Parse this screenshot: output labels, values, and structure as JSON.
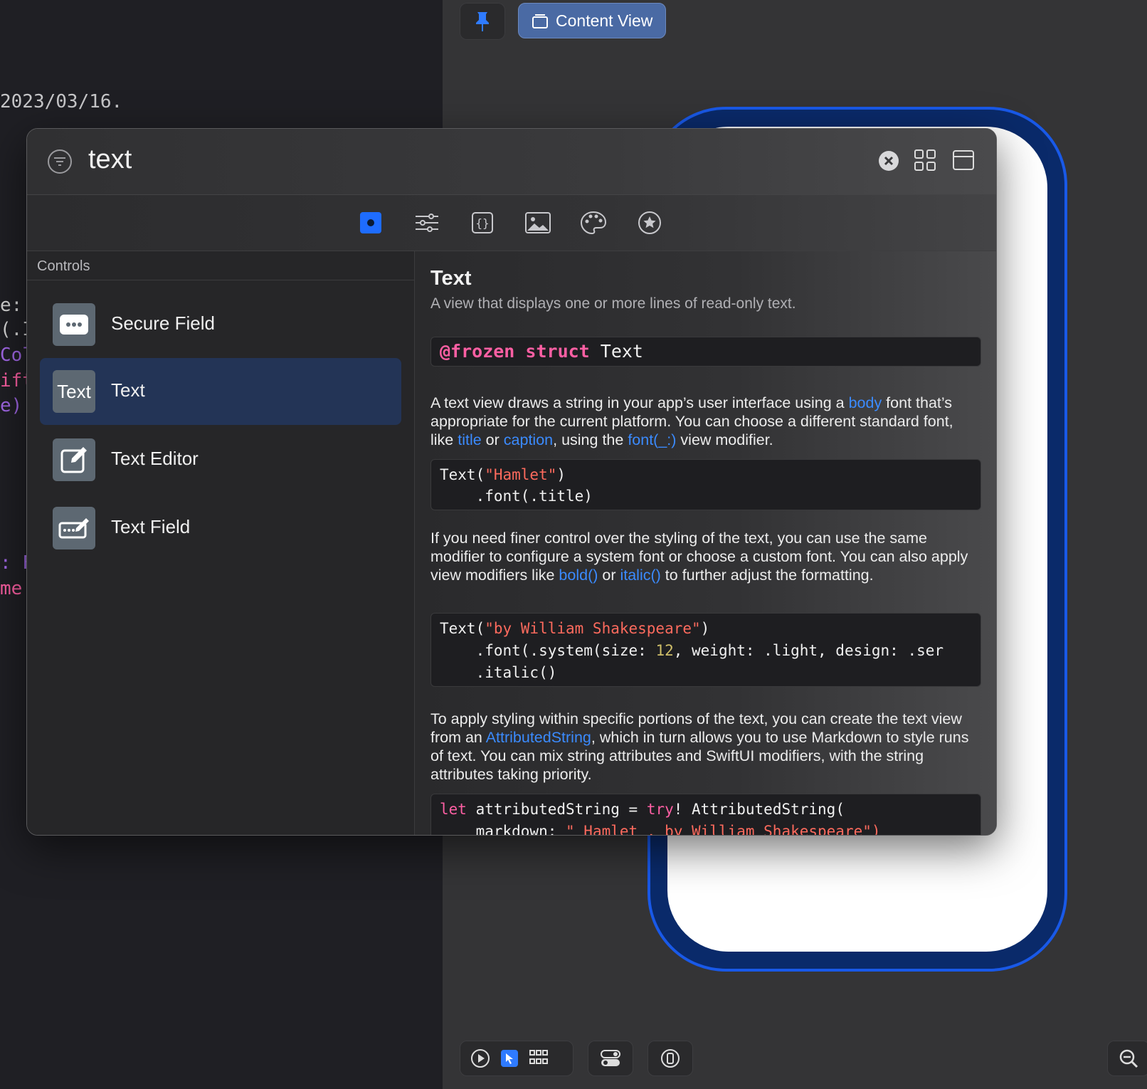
{
  "editor": {
    "date_line": "2023/03/16.",
    "fragments": [
      {
        "text": "e:",
        "color": "#d4d4d4"
      },
      {
        "text": "(.I",
        "color": "#d4d4d4"
      },
      {
        "text": "Col",
        "color": "#a167e6"
      },
      {
        "text": "ift",
        "color": "#fc5fa3"
      },
      {
        "text": "e)",
        "color": "#a167e6"
      },
      {
        "text": ": F",
        "color": "#a167e6"
      },
      {
        "text": "me",
        "color": "#fc5fa3"
      }
    ]
  },
  "canvas_toolbar": {
    "pin_icon": "pin-icon",
    "content_view_label": "Content View"
  },
  "library": {
    "search": {
      "value": "text"
    },
    "tabs": [
      "views-tab",
      "modifiers-tab",
      "snippets-tab",
      "images-tab",
      "colors-tab",
      "favorites-tab"
    ],
    "section_label": "Controls",
    "items": [
      {
        "label": "Secure Field",
        "icon": "secure-field-icon"
      },
      {
        "label": "Text",
        "icon_text": "Text",
        "selected": true
      },
      {
        "label": "Text Editor",
        "icon": "text-editor-icon"
      },
      {
        "label": "Text Field",
        "icon": "text-field-icon"
      }
    ],
    "detail": {
      "title": "Text",
      "subtitle": "A view that displays one or more lines of read-only text.",
      "declaration": {
        "kw": "@frozen struct",
        "name": "Text"
      },
      "p1": {
        "a": "A text view draws a string in your app’s user interface using a ",
        "link1": "body",
        "b": " font that’s appropriate for the current platform. You can choose a different standard font, like ",
        "link2": "title",
        "c": " or ",
        "link3": "caption",
        "d": ", using the ",
        "link4": "font(_:)",
        "e": " view modifier."
      },
      "code1": {
        "l1_a": "Text(",
        "l1_str": "\"Hamlet\"",
        "l1_b": ")",
        "l2": "    .font(.title)"
      },
      "p2": {
        "a": "If you need finer control over the styling of the text, you can use the same modifier to configure a system font or choose a custom font. You can also apply view modifiers like ",
        "link1": "bold()",
        "b": " or ",
        "link2": "italic()",
        "c": " to further adjust the formatting."
      },
      "code2": {
        "l1_a": "Text(",
        "l1_str": "\"by William Shakespeare\"",
        "l1_b": ")",
        "l2_a": "    .font(.system(size: ",
        "l2_num": "12",
        "l2_b": ", weight: .light, design: .ser",
        "l3": "    .italic()"
      },
      "p3": {
        "a": "To apply styling within specific portions of the text, you can create the text view from an ",
        "link1": "AttributedString",
        "b": ", which in turn allows you to use Markdown to style runs of text. You can mix string attributes and SwiftUI modifiers, with the string attributes taking priority."
      },
      "code3": {
        "l1_kw": "let",
        "l1_a": " attributedString = ",
        "l1_kw2": "try",
        "l1_b": "! AttributedString(",
        "l2_a": "    markdown: ",
        "l2_str": "\"_Hamlet_, by William Shakespeare\")"
      }
    }
  },
  "colors": {
    "accent": "#1959e8",
    "selection": "#233456",
    "link": "#3b8bff"
  }
}
